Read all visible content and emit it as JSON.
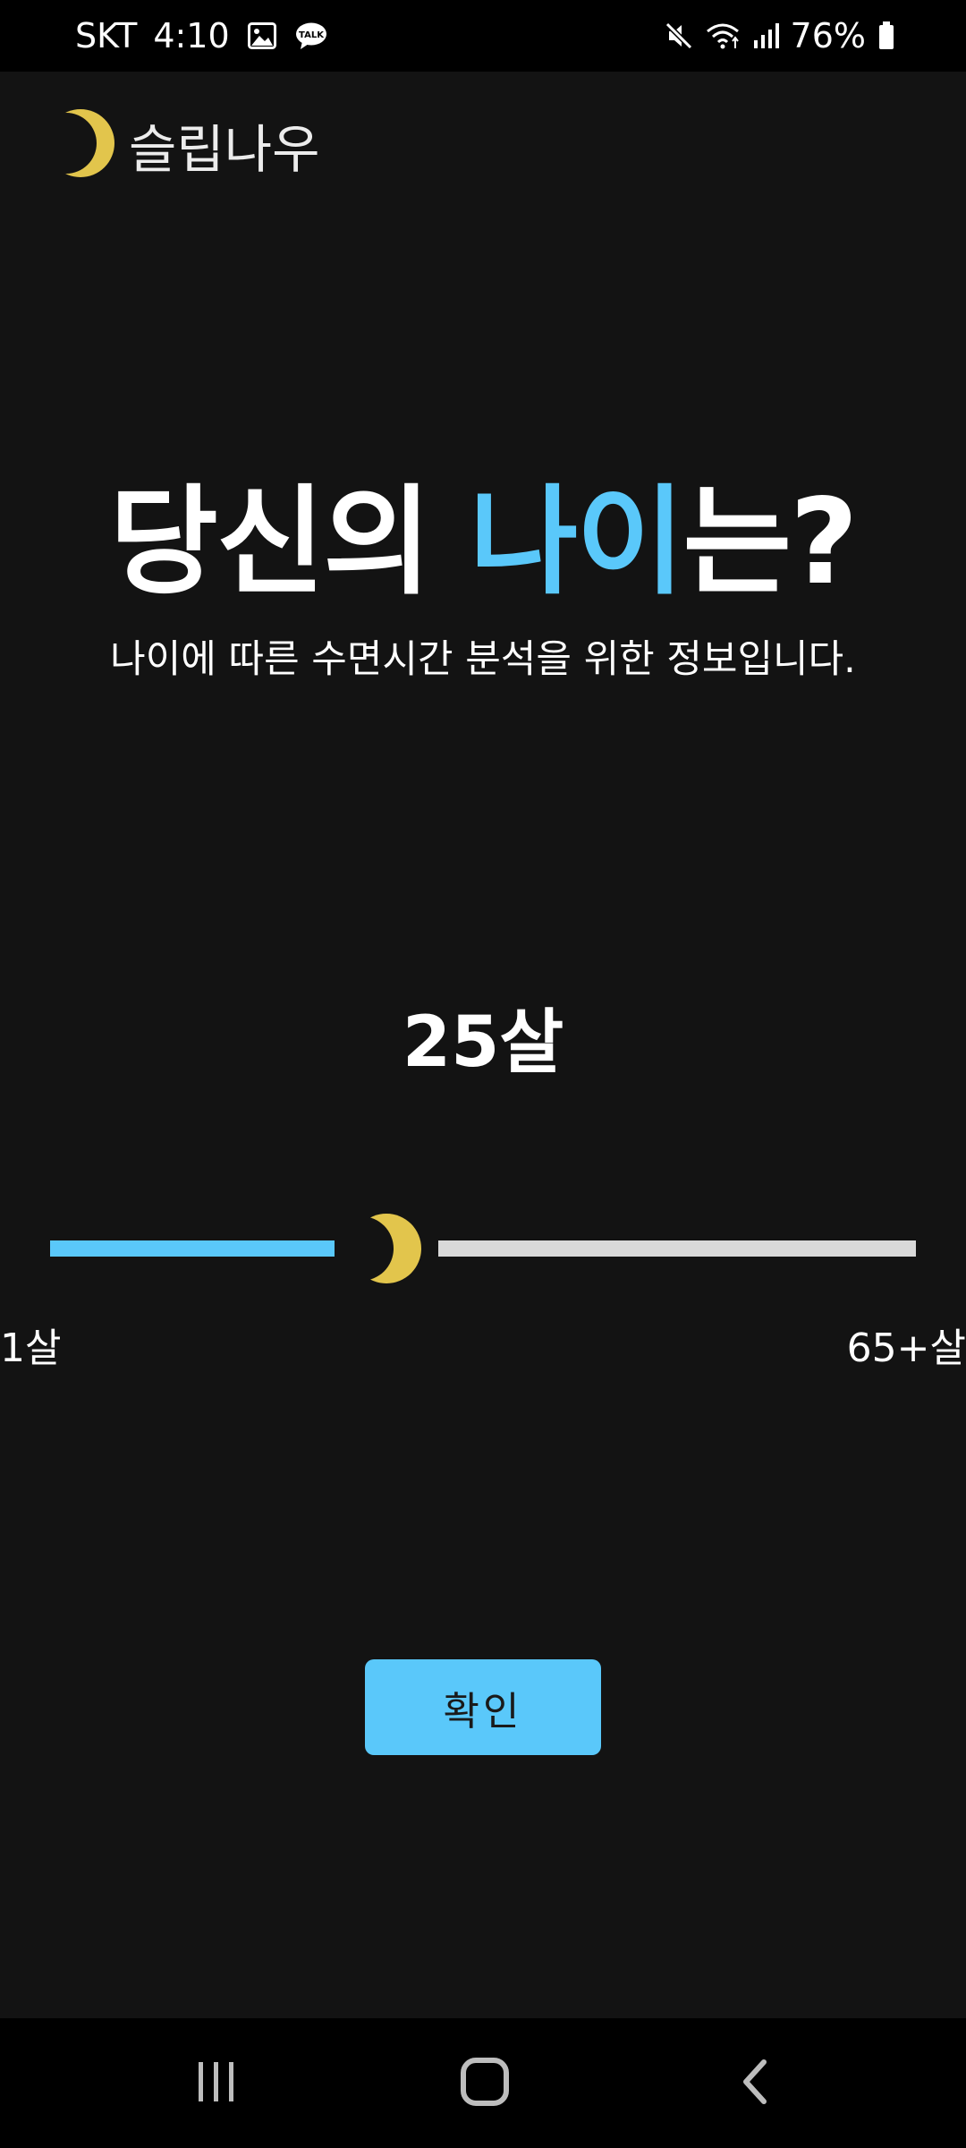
{
  "status_bar": {
    "carrier": "SKT",
    "time": "4:10",
    "left_icons": [
      "image-icon",
      "kakaotalk-icon"
    ],
    "talk_badge": "TALK",
    "right_icons": [
      "mute-icon",
      "wifi-icon",
      "signal-icon",
      "battery-icon"
    ],
    "battery_percent": "76%"
  },
  "header": {
    "logo_icon": "crescent-moon-icon",
    "app_name": "슬립나우"
  },
  "question": {
    "headline_prefix": "당신의 ",
    "headline_accent": "나이",
    "headline_suffix": "는?",
    "subtitle": "나이에 따른 수면시간 분석을 위한 정보입니다."
  },
  "age": {
    "display": "25살",
    "min_label": "1살",
    "max_label": "65+살",
    "value": 25,
    "min": 1,
    "max": 65,
    "thumb_icon": "crescent-moon-icon"
  },
  "actions": {
    "confirm_label": "확인"
  },
  "nav_bar": {
    "icons": [
      "recent-apps-icon",
      "home-icon",
      "back-icon"
    ]
  },
  "colors": {
    "background": "#131313",
    "accent": "#5ac8fa",
    "moon": "#e2c54c",
    "track_empty": "#d9d9d9",
    "button_text": "#1a1a1a"
  }
}
